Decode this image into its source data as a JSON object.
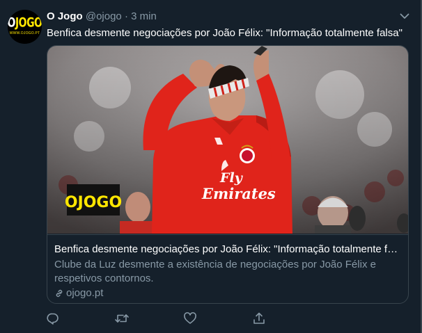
{
  "tweet": {
    "author_name": "O Jogo",
    "handle": "@ojogo",
    "separator": "·",
    "time": "3 min",
    "text": "Benfica desmente negociações por João Félix: \"Informação totalmente falsa\""
  },
  "avatar": {
    "logo_letter": "O",
    "logo_rest": "JOGO",
    "logo_url": "WWW.OJOGO.PT"
  },
  "card": {
    "image_logo_text": "OJOGO",
    "title": "Benfica desmente negociações por João Félix: \"Informação totalmente falsa\"",
    "description": "Clube da Luz desmente a existência de negociações por João Félix e respetivos contornos.",
    "domain": "ojogo.pt",
    "shirt_sponsor_line1": "Fly",
    "shirt_sponsor_line2": "Emirates"
  },
  "colors": {
    "background": "#15202b",
    "border": "#38444d",
    "secondary_text": "#8899a6",
    "logo_yellow": "#ffe600",
    "jersey_red": "#e0241b"
  },
  "icons": [
    "chevron-down-icon",
    "link-icon",
    "reply-icon",
    "retweet-icon",
    "like-icon",
    "share-icon"
  ]
}
